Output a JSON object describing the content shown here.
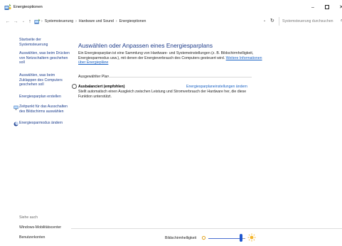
{
  "window": {
    "title": "Energieoptionen",
    "icon": "power-options-icon",
    "controls": {
      "minimize": "–",
      "maximize": "□",
      "close": "✕"
    }
  },
  "addressbar": {
    "back": "←",
    "forward": "→",
    "recent": "⌄",
    "up": "↑",
    "breadcrumb": [
      {
        "label": "Systemsteuerung"
      },
      {
        "label": "Hardware und Sound"
      },
      {
        "label": "Energieoptionen"
      }
    ],
    "separator": "›",
    "dropdown": "⌄",
    "refresh": "↻",
    "search_placeholder": "Systemsteuerung durchsuchen"
  },
  "sidebar": {
    "home": "Startseite der Systemsteuerung",
    "links": [
      {
        "label": "Auswählen, was beim Drücken von Netzschaltern geschehen soll"
      },
      {
        "label": "Auswählen, was beim Zuklappen des Computers geschehen soll"
      },
      {
        "label": "Energiesparplan erstellen"
      },
      {
        "label": "Zeitpunkt für das Ausschalten des Bildschirms auswählen",
        "icon": "display-icon"
      },
      {
        "label": "Energiesparmodus ändern",
        "icon": "moon-icon"
      }
    ],
    "see_also": {
      "label": "Siehe auch",
      "links": [
        "Windows-Mobilitätscenter",
        "Benutzerkonten"
      ]
    }
  },
  "main": {
    "title": "Auswählen oder Anpassen eines Energiesparplans",
    "description": "Ein Energiesparplan ist eine Sammlung von Hardware- und Systemeinstellungen (z. B. Bildschirmhelligkeit, Energiesparmodus usw.), mit denen der Energieverbrauch des Computers gesteuert wird.",
    "description_link": "Weitere Informationen über Energiepläne",
    "section_label": "Ausgewählter Plan",
    "plan": {
      "name": "Ausbalanciert (empfohlen)",
      "settings_link": "Energiesparplaneinstellungen ändern",
      "description": "Stellt automatisch einen Ausgleich zwischen Leistung und Stromverbrauch der Hardware her, die diese Funktion unterstützt.",
      "selected": true
    }
  },
  "brightness": {
    "label": "Bildschirmhelligkeit",
    "level_fraction": 0.88
  },
  "colors": {
    "link": "#1a62c4",
    "title_blue": "#1e3c8a",
    "slider_thumb": "#1f58d0"
  }
}
